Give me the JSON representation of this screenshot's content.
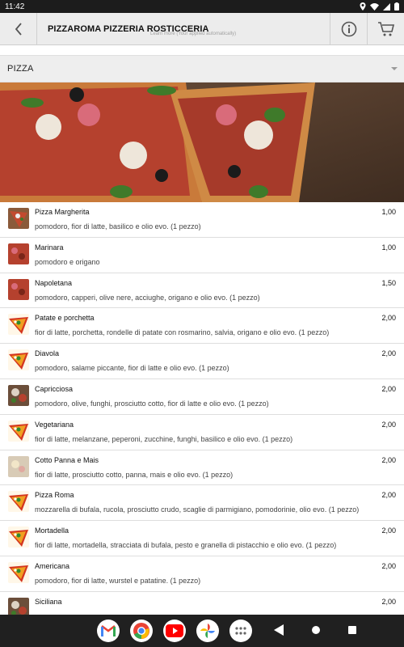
{
  "status_bar": {
    "time": "11:42",
    "icons": [
      "location-icon",
      "wifi-icon",
      "signal-icon",
      "battery-icon"
    ]
  },
  "header": {
    "title": "PIZZAROMA PIZZERIA ROSTICCERIA",
    "subtitle": "Learn more (Your applied automatically)",
    "icons": [
      "back-arrow-icon",
      "info-icon",
      "cart-icon"
    ]
  },
  "category": {
    "label": "PIZZA"
  },
  "menu": {
    "items": [
      {
        "name": "Pizza Margherita",
        "desc": "pomodoro, fior di latte, basilico e olio evo. (1 pezzo)",
        "price": "1,00",
        "thumb": "cheese"
      },
      {
        "name": "Marinara",
        "desc": "pomodoro e origano",
        "price": "1,00",
        "thumb": "red"
      },
      {
        "name": "Napoletana",
        "desc": "pomodoro, capperi, olive nere, acciughe, origano e olio evo. (1 pezzo)",
        "price": "1,50",
        "thumb": "red"
      },
      {
        "name": "Patate e porchetta",
        "desc": "fior di latte, porchetta, rondelle di patate con rosmarino, salvia, origano e olio evo. (1 pezzo)",
        "price": "2,00",
        "thumb": "generic"
      },
      {
        "name": "Diavola",
        "desc": "pomodoro, salame piccante, fior di latte e olio evo. (1 pezzo)",
        "price": "2,00",
        "thumb": "generic"
      },
      {
        "name": "Capricciosa",
        "desc": "pomodoro, olive, funghi, prosciutto cotto, fior di latte e olio evo. (1 pezzo)",
        "price": "2,00",
        "thumb": "mixed"
      },
      {
        "name": "Vegetariana",
        "desc": "fior di latte, melanzane, peperoni, zucchine, funghi, basilico e olio evo. (1 pezzo)",
        "price": "2,00",
        "thumb": "generic"
      },
      {
        "name": "Cotto Panna e Mais",
        "desc": "fior di latte, prosciutto cotto, panna, mais e olio evo. (1 pezzo)",
        "price": "2,00",
        "thumb": "pale"
      },
      {
        "name": "Pizza Roma",
        "desc": "mozzarella di bufala, rucola, prosciutto crudo, scaglie di parmigiano, pomodorinie, olio evo. (1 pezzo)",
        "price": "2,00",
        "thumb": "generic"
      },
      {
        "name": "Mortadella",
        "desc": "fior di latte, mortadella, stracciata di bufala, pesto e granella di pistacchio e olio evo. (1 pezzo)",
        "price": "2,00",
        "thumb": "generic"
      },
      {
        "name": "Americana",
        "desc": "pomodoro, fior di latte, wurstel e patatine. (1 pezzo)",
        "price": "2,00",
        "thumb": "generic"
      },
      {
        "name": "Siciliana",
        "desc": "",
        "price": "2,00",
        "thumb": "mixed"
      }
    ]
  },
  "nav": {
    "dock": [
      "gmail-icon",
      "chrome-icon",
      "youtube-icon",
      "photos-icon",
      "app-drawer-icon"
    ],
    "buttons": [
      "back-nav-icon",
      "home-nav-icon",
      "recents-nav-icon"
    ]
  },
  "colors": {
    "header_bg": "#ececec",
    "category_bg": "#eeeeee",
    "status_bg": "#1c1c1c",
    "nav_bg": "#202020"
  }
}
